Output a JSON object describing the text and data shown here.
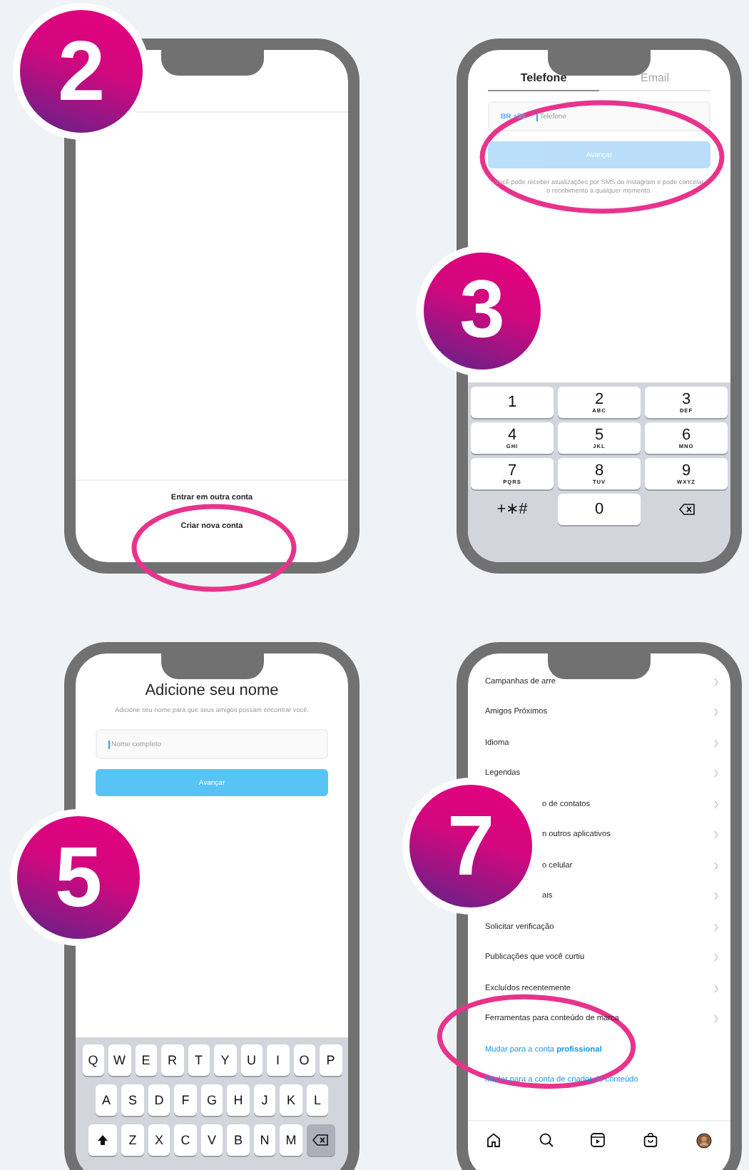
{
  "steps": [
    {
      "kind": "accounts",
      "number": "2",
      "options": [
        "Entrar em outra conta",
        "Criar nova conta"
      ]
    },
    {
      "kind": "phone",
      "number": "3",
      "tabs": [
        {
          "label": "Telefone",
          "selected": true
        },
        {
          "label": "Email",
          "selected": false
        }
      ],
      "country_code": "BR +55",
      "placeholder": "Telefone",
      "button": {
        "label": "Avançar",
        "disabled": true
      },
      "note": "Você pode receber atualizações por SMS do Instagram e pode cancelar o recebimento a qualquer momento.",
      "keypad": [
        {
          "kind": "key",
          "label": "1"
        },
        {
          "kind": "key",
          "label": "2",
          "letters": "ABC"
        },
        {
          "kind": "key",
          "label": "3",
          "letters": "DEF"
        },
        {
          "kind": "key",
          "label": "4",
          "letters": "GHI"
        },
        {
          "kind": "key",
          "label": "5",
          "letters": "JKL"
        },
        {
          "kind": "key",
          "label": "6",
          "letters": "MNO"
        },
        {
          "kind": "key",
          "label": "7",
          "letters": "PQRS"
        },
        {
          "kind": "key",
          "label": "8",
          "letters": "TUV"
        },
        {
          "kind": "key",
          "label": "9",
          "letters": "WXYZ"
        },
        {
          "kind": "plain",
          "label": "+∗#"
        },
        {
          "kind": "key",
          "label": "0"
        },
        {
          "kind": "delete"
        }
      ]
    },
    {
      "kind": "name",
      "number": "5",
      "title": "Adicione seu nome",
      "subtitle": "Adicione seu nome para que seus amigos possam encontrar você.",
      "placeholder": "Nome completo",
      "button": {
        "label": "Avançar",
        "disabled": false
      },
      "keyboard": [
        [
          "Q",
          "W",
          "E",
          "R",
          "T",
          "Y",
          "U",
          "I",
          "O",
          "P"
        ],
        [
          "A",
          "S",
          "D",
          "F",
          "G",
          "H",
          "J",
          "K",
          "L"
        ],
        [
          "Z",
          "X",
          "C",
          "V",
          "B",
          "N",
          "M"
        ]
      ]
    },
    {
      "kind": "settings",
      "number": "7",
      "items": [
        {
          "kind": "row",
          "label": "Campanhas de arre",
          "covered": false
        },
        {
          "kind": "row",
          "label": "Amigos Próximos",
          "covered": false
        },
        {
          "kind": "row",
          "label": "Idioma",
          "covered": false
        },
        {
          "kind": "row",
          "label": "Legendas",
          "covered": false
        },
        {
          "kind": "row",
          "label": "o de contatos",
          "covered": true
        },
        {
          "kind": "row",
          "label": "n outros aplicativos",
          "covered": true
        },
        {
          "kind": "row",
          "label": "o celular",
          "covered": true
        },
        {
          "kind": "row",
          "label": "ais",
          "covered": true
        },
        {
          "kind": "row",
          "label": "Solicitar verificação",
          "covered": false
        },
        {
          "kind": "row",
          "label": "Publicações que você curtiu",
          "covered": false
        },
        {
          "kind": "row",
          "label": "Excluídos recentemente",
          "covered": false
        },
        {
          "kind": "row",
          "label": "Ferramentas para conteúdo de marca",
          "covered": false
        },
        {
          "kind": "link",
          "label": "Mudar para a conta **profissional**",
          "covered": false
        },
        {
          "kind": "link",
          "label": "Mudar para a conta de criador de conteúdo",
          "covered": false
        }
      ]
    }
  ]
}
